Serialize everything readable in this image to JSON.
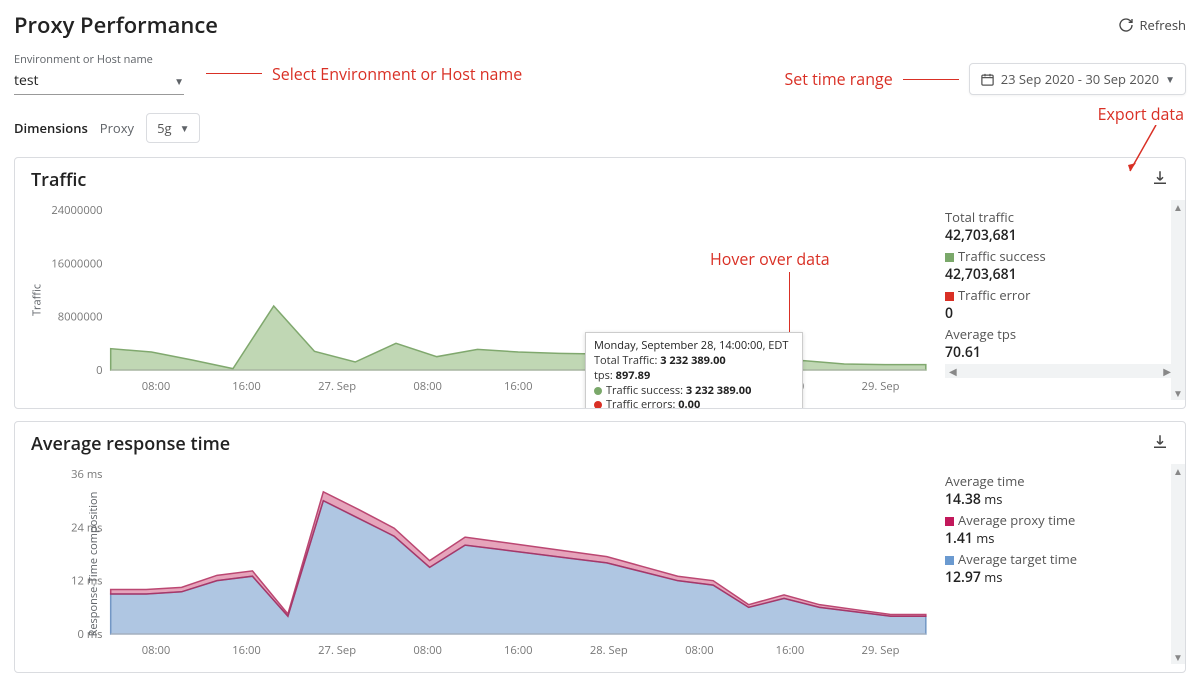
{
  "page": {
    "title": "Proxy Performance",
    "refresh": "Refresh"
  },
  "env": {
    "label": "Environment or Host name",
    "value": "test"
  },
  "annotations": {
    "env": "Select Environment or Host name",
    "daterange": "Set time range",
    "hover": "Hover over data",
    "export": "Export data"
  },
  "daterange": {
    "text": "23 Sep 2020 - 30 Sep 2020"
  },
  "dimensions": {
    "label_strong": "Dimensions",
    "label": "Proxy",
    "value": "5g"
  },
  "traffic_card": {
    "title": "Traffic",
    "stats": {
      "total_label": "Total traffic",
      "total_value": "42,703,681",
      "success_label": "Traffic success",
      "success_value": "42,703,681",
      "error_label": "Traffic error",
      "error_value": "0",
      "tps_label": "Average tps",
      "tps_value": "70.61"
    },
    "tooltip": {
      "ts": "Monday, September 28, 14:00:00, EDT",
      "total_k": "Total Traffic:",
      "total_v": "3 232 389.00",
      "tps_k": "tps:",
      "tps_v": "897.89",
      "succ_k": "Traffic success:",
      "succ_v": "3 232 389.00",
      "err_k": "Traffic errors:",
      "err_v": "0.00"
    }
  },
  "response_card": {
    "title": "Average response time",
    "stats": {
      "avg_label": "Average time",
      "avg_value": "14.38",
      "avg_unit": "ms",
      "proxy_label": "Average proxy time",
      "proxy_value": "1.41",
      "proxy_unit": "ms",
      "target_label": "Average target time",
      "target_value": "12.97",
      "target_unit": "ms"
    }
  },
  "chart_data": [
    {
      "type": "area",
      "title": "Traffic",
      "ylabel": "Traffic",
      "ylim": [
        0,
        24000000
      ],
      "y_ticks": [
        0,
        8000000,
        16000000,
        24000000
      ],
      "categories": [
        "08:00",
        "16:00",
        "27. Sep",
        "08:00",
        "16:00",
        "28. Sep",
        "08:00",
        "16:00",
        "29. Sep"
      ],
      "x_ticks": [
        "08:00",
        "16:00",
        "27. Sep",
        "08:00",
        "16:00",
        "28. Sep",
        "08:00",
        "16:00",
        "29. Sep"
      ],
      "series": [
        {
          "name": "Traffic success",
          "color": "#7aa86a",
          "values": [
            3200000,
            2700000,
            1500000,
            200000,
            9600000,
            2800000,
            1200000,
            4000000,
            2000000,
            3100000,
            2700000,
            2500000,
            2400000,
            2300000,
            2200000,
            3200000,
            300000,
            1400000,
            900000,
            800000,
            800000
          ]
        },
        {
          "name": "Traffic error",
          "color": "#d93025",
          "values": [
            0,
            0,
            0,
            0,
            0,
            0,
            0,
            0,
            0,
            0,
            0,
            0,
            0,
            0,
            0,
            0,
            0,
            0,
            0,
            0,
            0
          ]
        }
      ]
    },
    {
      "type": "area",
      "title": "Average response time",
      "ylabel": "Response-Time composition",
      "ylim": [
        0,
        36
      ],
      "y_ticks": [
        "0 ms",
        "12 ms",
        "24 ms",
        "36 ms"
      ],
      "categories": [
        "08:00",
        "16:00",
        "27. Sep",
        "08:00",
        "16:00",
        "28. Sep",
        "08:00",
        "16:00",
        "29. Sep"
      ],
      "x_ticks": [
        "08:00",
        "16:00",
        "27. Sep",
        "08:00",
        "16:00",
        "28. Sep",
        "08:00",
        "16:00",
        "29. Sep"
      ],
      "series": [
        {
          "name": "Average target time",
          "color": "#6b9ad0",
          "values": [
            9,
            9,
            9.5,
            12,
            13,
            4,
            30,
            26,
            22,
            15,
            20,
            19,
            18,
            17,
            16,
            14,
            12,
            11,
            6,
            8,
            6,
            5,
            4,
            4
          ]
        },
        {
          "name": "Average proxy time",
          "color": "#c2185b",
          "values": [
            1,
            1,
            1,
            1.2,
            1.2,
            0.5,
            2,
            2,
            1.8,
            1.5,
            1.8,
            1.7,
            1.6,
            1.5,
            1.4,
            1.2,
            1,
            1,
            0.6,
            0.8,
            0.6,
            0.5,
            0.4,
            0.4
          ]
        }
      ]
    }
  ]
}
